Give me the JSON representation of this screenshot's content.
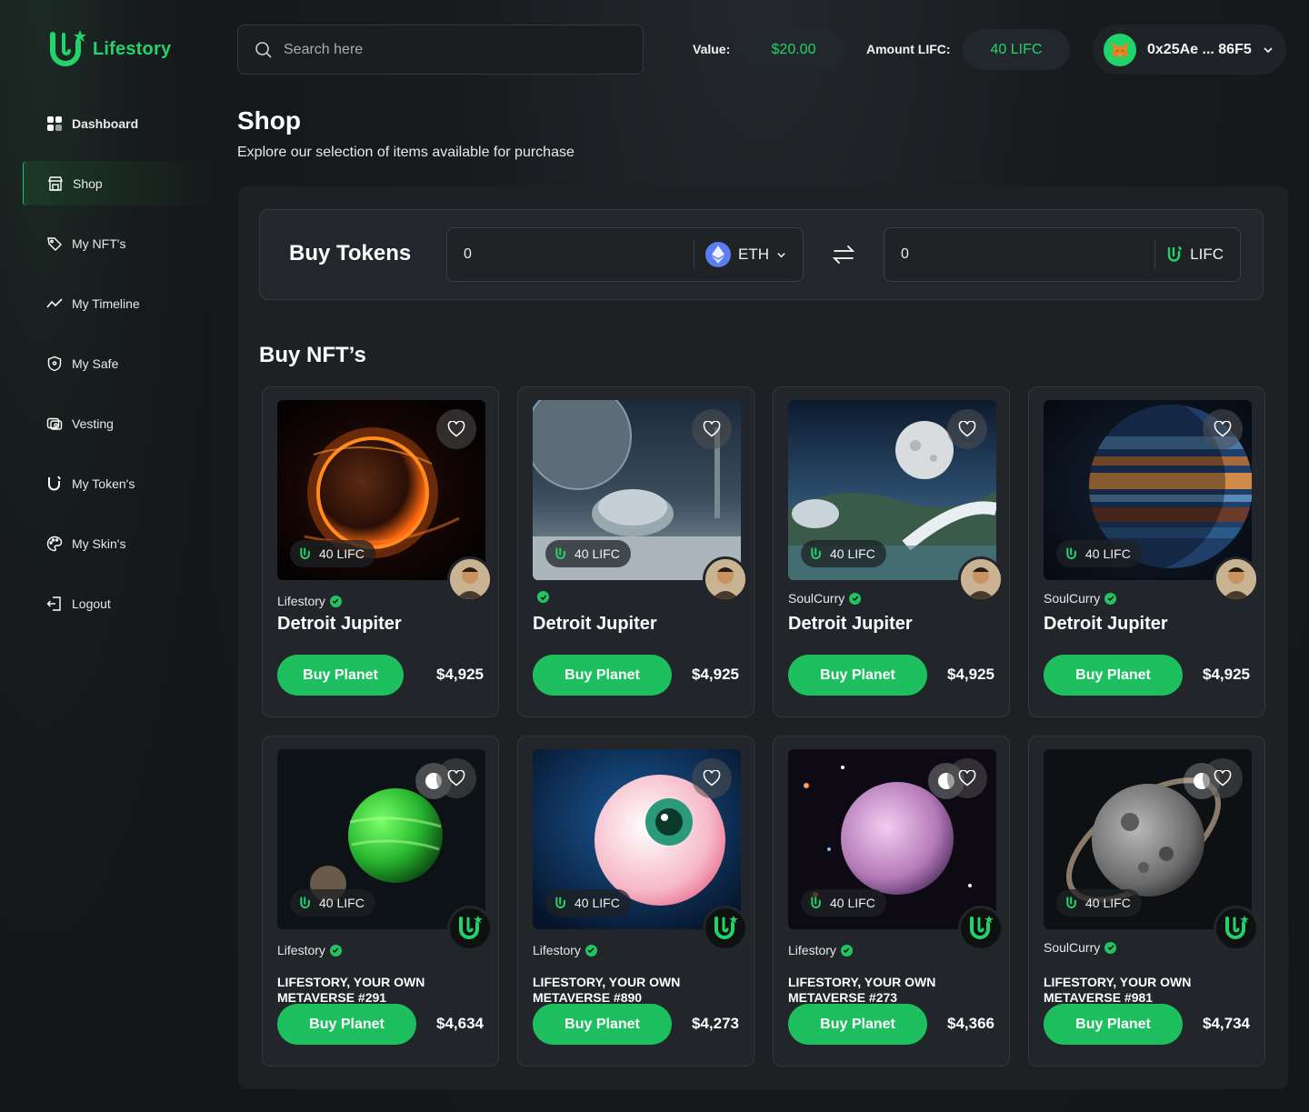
{
  "brand": {
    "name": "Lifestory"
  },
  "sidebar": {
    "items": [
      {
        "label": "Dashboard",
        "icon": "grid-icon"
      },
      {
        "label": "Shop",
        "icon": "store-icon"
      },
      {
        "label": "My NFT's",
        "icon": "tag-icon"
      },
      {
        "label": "My Timeline",
        "icon": "trend-icon"
      },
      {
        "label": "My Safe",
        "icon": "shield-icon"
      },
      {
        "label": "Vesting",
        "icon": "vesting-icon"
      },
      {
        "label": "My Token's",
        "icon": "lifc-icon"
      },
      {
        "label": "My Skin's",
        "icon": "palette-icon"
      },
      {
        "label": "Logout",
        "icon": "logout-icon"
      }
    ],
    "active": "Shop"
  },
  "header": {
    "search_placeholder": "Search here",
    "value_label": "Value:",
    "value": "$20.00",
    "amount_label": "Amount LIFC:",
    "amount": "40 LIFC",
    "wallet_address": "0x25Ae ... 86F5"
  },
  "page": {
    "title": "Shop",
    "subtitle": "Explore our selection of items available for purchase"
  },
  "buy_tokens": {
    "title": "Buy Tokens",
    "from_value": "0",
    "from_token": "ETH",
    "to_value": "0",
    "to_token": "LIFC"
  },
  "nfts": {
    "title": "Buy NFT’s",
    "button_label": "Buy Planet",
    "items": [
      {
        "creator": "Lifestory",
        "name": "Detroit Jupiter",
        "tag": "40 LIFC",
        "price": "$4,925"
      },
      {
        "creator": "",
        "name": "Detroit Jupiter",
        "tag": "40 LIFC",
        "price": "$4,925"
      },
      {
        "creator": "SoulCurry",
        "name": "Detroit Jupiter",
        "tag": "40 LIFC",
        "price": "$4,925"
      },
      {
        "creator": "SoulCurry",
        "name": "Detroit Jupiter",
        "tag": "40 LIFC",
        "price": "$4,925"
      },
      {
        "creator": "Lifestory",
        "name": "LIFESTORY, YOUR OWN METAVERSE #291",
        "tag": "40 LIFC",
        "price": "$4,634"
      },
      {
        "creator": "Lifestory",
        "name": "LIFESTORY, YOUR OWN METAVERSE #890",
        "tag": "40 LIFC",
        "price": "$4,273"
      },
      {
        "creator": "Lifestory",
        "name": "LIFESTORY, YOUR OWN METAVERSE #273",
        "tag": "40 LIFC",
        "price": "$4,366"
      },
      {
        "creator": "SoulCurry",
        "name": "LIFESTORY, YOUR OWN METAVERSE #981",
        "tag": "40 LIFC",
        "price": "$4,734"
      }
    ]
  },
  "colors": {
    "accent": "#22d36b",
    "button": "#1dbf5f",
    "background": "#141619",
    "card": "#22262a"
  }
}
